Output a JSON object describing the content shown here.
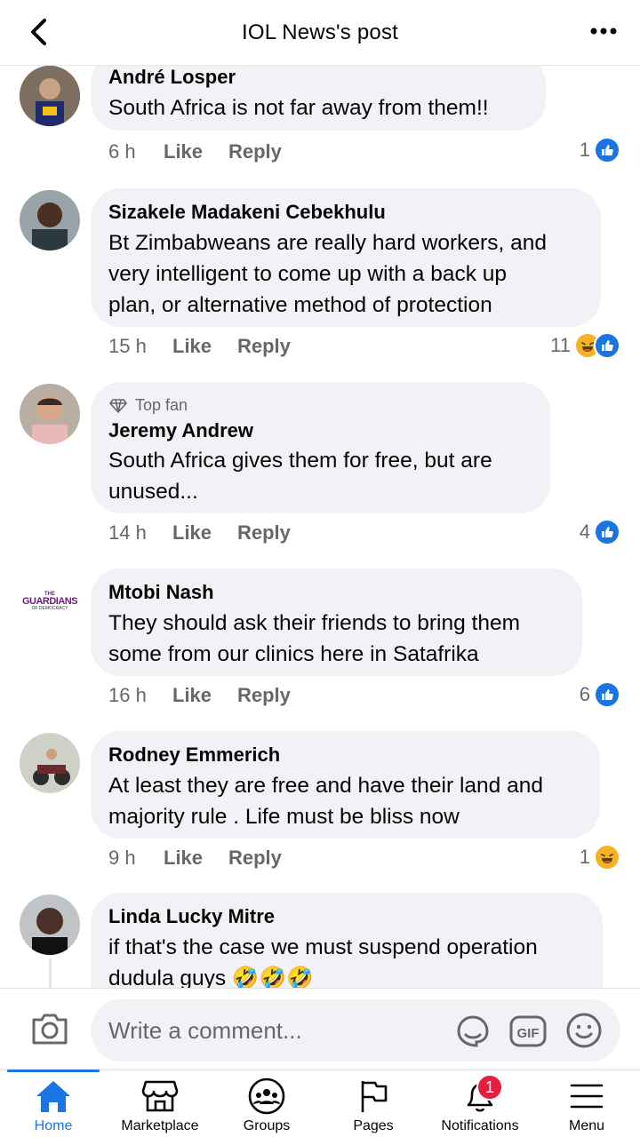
{
  "header": {
    "title": "IOL News's post"
  },
  "comments": [
    {
      "name": "André Losper",
      "lines": [
        "South Africa is not far away from them!!"
      ],
      "time": "6 h",
      "like": "Like",
      "reply": "Reply",
      "reaction_count": "1",
      "reactions": [
        "like"
      ]
    },
    {
      "name": "Sizakele Madakeni Cebekhulu",
      "lines": [
        "Bt Zimbabweans are really hard workers, and",
        "very intelligent to come up with a back up",
        "plan, or alternative method of protection"
      ],
      "time": "15 h",
      "like": "Like",
      "reply": "Reply",
      "reaction_count": "11",
      "reactions": [
        "haha",
        "like"
      ]
    },
    {
      "badge": "Top fan",
      "name": "Jeremy Andrew",
      "lines": [
        "South Africa gives them for free, but are",
        "unused..."
      ],
      "time": "14 h",
      "like": "Like",
      "reply": "Reply",
      "reaction_count": "4",
      "reactions": [
        "like"
      ]
    },
    {
      "name": "Mtobi Nash",
      "avatar_logo": [
        "THE",
        "GUARDIANS",
        "OF DEMOCRACY"
      ],
      "lines": [
        "They should ask their friends to bring them",
        "some from our clinics here in Satafrika"
      ],
      "time": "16 h",
      "like": "Like",
      "reply": "Reply",
      "reaction_count": "6",
      "reactions": [
        "like"
      ]
    },
    {
      "name": "Rodney Emmerich",
      "lines": [
        "At least they are free and have their land and",
        "majority rule . Life must be bliss now"
      ],
      "time": "9 h",
      "like": "Like",
      "reply": "Reply",
      "reaction_count": "1",
      "reactions": [
        "haha"
      ]
    },
    {
      "name": "Linda Lucky Mitre",
      "lines": [
        "if that's the case we must suspend operation",
        "dudula guys 🤣🤣🤣"
      ]
    }
  ],
  "composer": {
    "placeholder": "Write a comment..."
  },
  "nav": [
    {
      "label": "Home",
      "icon": "home-icon",
      "active": true
    },
    {
      "label": "Marketplace",
      "icon": "marketplace-icon"
    },
    {
      "label": "Groups",
      "icon": "groups-icon"
    },
    {
      "label": "Pages",
      "icon": "pages-flag-icon"
    },
    {
      "label": "Notifications",
      "icon": "bell-icon",
      "badge": "1"
    },
    {
      "label": "Menu",
      "icon": "hamburger-menu-icon"
    }
  ],
  "colors": {
    "accent": "#1b74e4",
    "bubble": "#f0f2f5",
    "muted": "#65676b",
    "badge": "#e41e3f",
    "haha": "#f7b125"
  }
}
